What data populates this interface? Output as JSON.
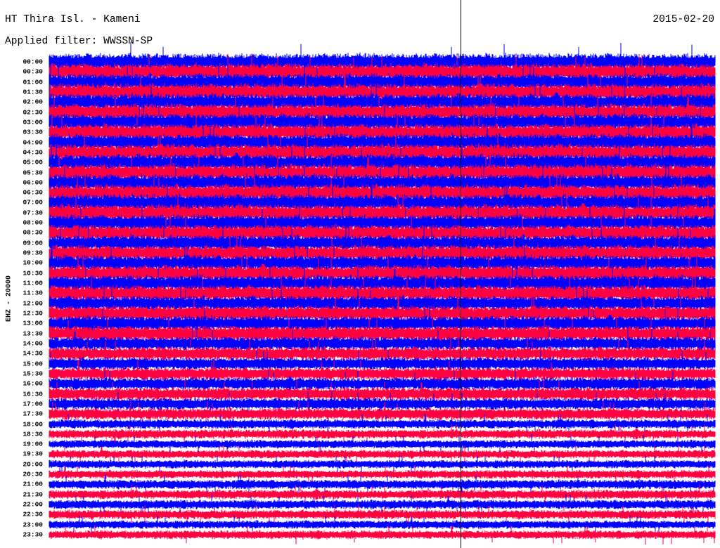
{
  "chart_data": {
    "type": "line",
    "subtype": "helicorder",
    "title": "HT Thira Isl. - Kameni",
    "date": "2015-02-20",
    "filter_label": "Applied filter: WWSSN-SP",
    "ylabel": "EHZ - 20000",
    "tick_labels": [
      "00:00",
      "00:30",
      "01:00",
      "01:30",
      "02:00",
      "02:30",
      "03:00",
      "03:30",
      "04:00",
      "04:30",
      "05:00",
      "05:30",
      "06:00",
      "06:30",
      "07:00",
      "07:30",
      "08:00",
      "08:30",
      "09:00",
      "09:30",
      "10:00",
      "10:30",
      "11:00",
      "11:30",
      "12:00",
      "12:30",
      "13:00",
      "13:30",
      "14:00",
      "14:30",
      "15:00",
      "15:30",
      "16:00",
      "16:30",
      "17:00",
      "17:30",
      "18:00",
      "18:30",
      "19:00",
      "19:30",
      "20:00",
      "20:30",
      "21:00",
      "21:30",
      "22:00",
      "22:30",
      "23:00",
      "23:30"
    ],
    "trace_colors": [
      "#0000ff",
      "#ff0040"
    ],
    "relative_amplitude": [
      1.0,
      1.0,
      1.0,
      1.0,
      1.0,
      1.0,
      1.0,
      1.0,
      1.0,
      1.0,
      1.0,
      1.0,
      1.0,
      1.0,
      1.0,
      1.0,
      0.95,
      0.95,
      0.95,
      0.95,
      0.95,
      0.95,
      0.95,
      0.95,
      0.9,
      0.9,
      0.9,
      0.9,
      0.8,
      0.8,
      0.75,
      0.75,
      0.75,
      0.75,
      0.7,
      0.7,
      0.55,
      0.55,
      0.5,
      0.5,
      0.5,
      0.5,
      0.55,
      0.55,
      0.55,
      0.55,
      0.5,
      0.5
    ],
    "marker_line": "current time"
  }
}
